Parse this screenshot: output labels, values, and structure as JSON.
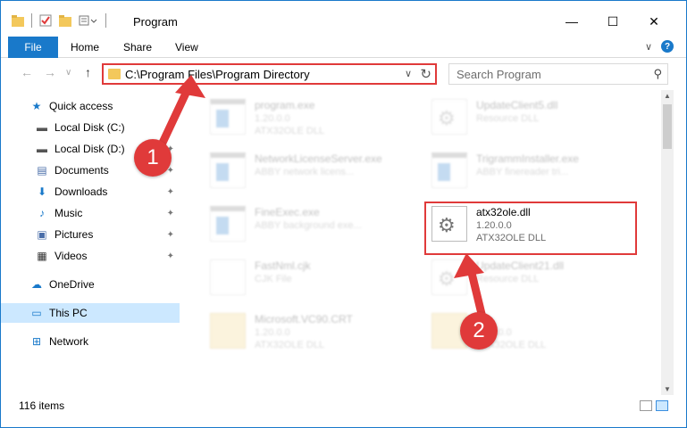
{
  "window": {
    "title": "Program",
    "minimize_glyph": "—",
    "maximize_glyph": "☐",
    "close_glyph": "✕"
  },
  "ribbon": {
    "file_tab": "File",
    "tabs": [
      "Home",
      "Share",
      "View"
    ],
    "expand_glyph": "∨",
    "help_glyph": "?"
  },
  "nav": {
    "back_glyph": "←",
    "forward_glyph": "→",
    "recent_glyph": "∨",
    "up_glyph": "↑",
    "address_path": "C:\\Program Files\\Program Directory",
    "address_dropdown_glyph": "∨",
    "refresh_glyph": "↻",
    "search_placeholder": "Search Program",
    "search_icon_glyph": "⚲"
  },
  "sidebar": {
    "items": [
      {
        "label": "Quick access",
        "icon": "star-icon",
        "glyph": "★",
        "color": "#1979ca",
        "pinned": false
      },
      {
        "label": "Local Disk (C:)",
        "icon": "drive-icon",
        "glyph": "▬",
        "color": "#555555",
        "pinned": true
      },
      {
        "label": "Local Disk (D:)",
        "icon": "drive-icon",
        "glyph": "▬",
        "color": "#555555",
        "pinned": true
      },
      {
        "label": "Documents",
        "icon": "documents-icon",
        "glyph": "▤",
        "color": "#4a6ea9",
        "pinned": true
      },
      {
        "label": "Downloads",
        "icon": "downloads-icon",
        "glyph": "⬇",
        "color": "#1979ca",
        "pinned": true
      },
      {
        "label": "Music",
        "icon": "music-icon",
        "glyph": "♪",
        "color": "#1979ca",
        "pinned": true
      },
      {
        "label": "Pictures",
        "icon": "pictures-icon",
        "glyph": "▣",
        "color": "#4a6ea9",
        "pinned": true
      },
      {
        "label": "Videos",
        "icon": "videos-icon",
        "glyph": "▦",
        "color": "#333333",
        "pinned": true
      },
      {
        "label": "OneDrive",
        "icon": "onedrive-icon",
        "glyph": "☁",
        "color": "#1979ca",
        "pinned": false
      },
      {
        "label": "This PC",
        "icon": "computer-icon",
        "glyph": "▭",
        "color": "#1979ca",
        "pinned": false,
        "selected": true
      },
      {
        "label": "Network",
        "icon": "network-icon",
        "glyph": "⊞",
        "color": "#1979ca",
        "pinned": false
      }
    ],
    "pin_glyph": "📌"
  },
  "files": [
    {
      "name": "program.exe",
      "line2": "1.20.0.0",
      "line3": "ATX32OLE DLL",
      "type": "exe"
    },
    {
      "name": "UpdateClient5.dll",
      "line2": "Resource DLL",
      "line3": "",
      "type": "dll"
    },
    {
      "name": "NetworkLicenseServer.exe",
      "line2": "ABBY network licens...",
      "line3": "",
      "type": "exe"
    },
    {
      "name": "TrigrammInstaller.exe",
      "line2": "ABBY finereader tri...",
      "line3": "",
      "type": "exe"
    },
    {
      "name": "FineExec.exe",
      "line2": "ABBY background exe...",
      "line3": "",
      "type": "exe"
    },
    {
      "name": "atx32ole.dll",
      "line2": "1.20.0.0",
      "line3": "ATX32OLE DLL",
      "type": "dll",
      "focus": true
    },
    {
      "name": "FastNml.cjk",
      "line2": "CJK File",
      "line3": "",
      "type": "doc"
    },
    {
      "name": "UpdateClient21.dll",
      "line2": "Resource DLL",
      "line3": "",
      "type": "dll"
    },
    {
      "name": "Microsoft.VC90.CRT",
      "line2": "1.20.0.0",
      "line3": "ATX32OLE DLL",
      "type": "folder"
    },
    {
      "name": "",
      "line2": "1.20.0.0",
      "line3": "ATX32OLE DLL",
      "type": "folder"
    }
  ],
  "status": {
    "item_count": "116 items"
  },
  "callouts": {
    "step1": "1",
    "step2": "2",
    "color": "#e03a3a"
  }
}
